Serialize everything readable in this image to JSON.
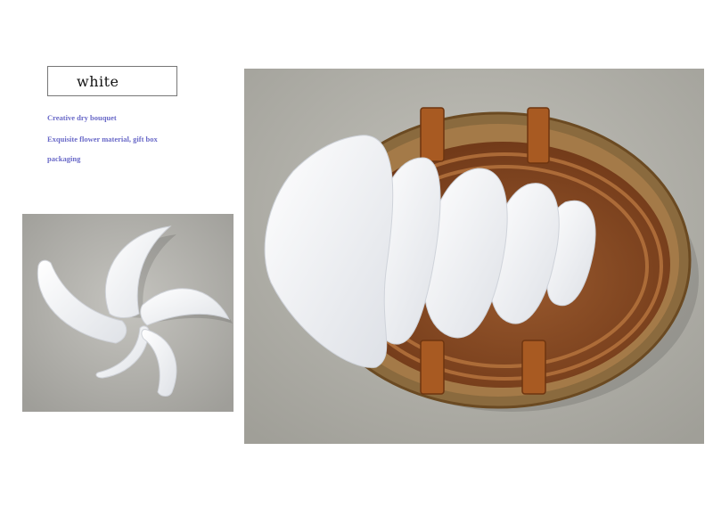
{
  "label": {
    "text": "white"
  },
  "description": {
    "line1": "Creative dry bouquet",
    "line2": "Exquisite flower material, gift box",
    "line3": "packaging"
  },
  "colors": {
    "description_text": "#6a6ac8",
    "pillow": "#f4f5f7",
    "basket": "#8a4a22",
    "backdrop": "#b5b4ad"
  }
}
